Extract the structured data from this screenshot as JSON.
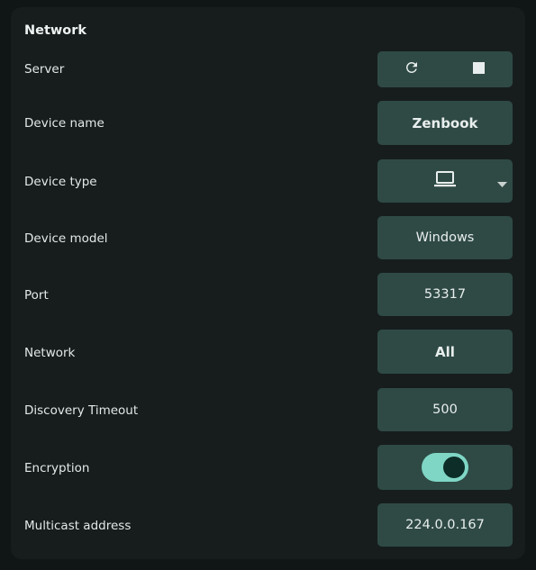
{
  "section": {
    "title": "Network"
  },
  "rows": {
    "server": {
      "label": "Server",
      "icons": [
        "refresh-icon",
        "stop-icon"
      ]
    },
    "device_name": {
      "label": "Device name",
      "value": "Zenbook"
    },
    "device_type": {
      "label": "Device type",
      "icon": "laptop-icon",
      "dropdown_icon": "caret-down-icon"
    },
    "device_model": {
      "label": "Device model",
      "value": "Windows"
    },
    "port": {
      "label": "Port",
      "value": "53317"
    },
    "network": {
      "label": "Network",
      "value": "All"
    },
    "discovery_timeout": {
      "label": "Discovery Timeout",
      "value": "500"
    },
    "encryption": {
      "label": "Encryption",
      "enabled": true
    },
    "multicast_address": {
      "label": "Multicast address",
      "value": "224.0.0.167"
    }
  },
  "colors": {
    "background": "#101515",
    "card": "#171d1d",
    "control": "#2f4a45",
    "toggle_track": "#7fd6c5",
    "toggle_knob": "#0c2d28"
  }
}
